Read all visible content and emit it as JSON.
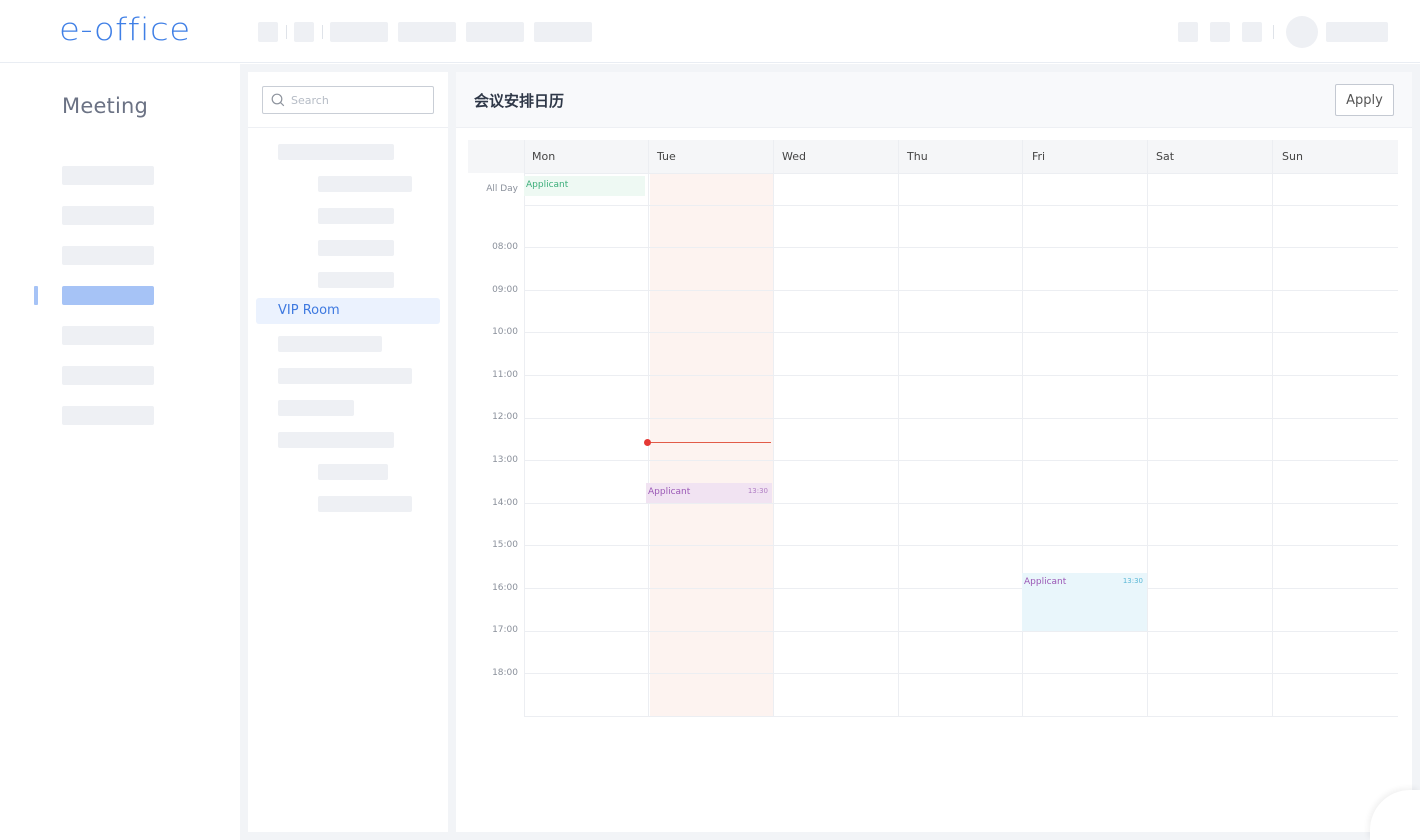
{
  "app": {
    "logo_text": "e-office"
  },
  "sidebar": {
    "title": "Meeting",
    "active_index": 3
  },
  "rooms": {
    "search_placeholder": "Search",
    "active_room": "VIP Room"
  },
  "calendar": {
    "title": "会议安排日历",
    "apply_label": "Apply",
    "days": [
      "Mon",
      "Tue",
      "Wed",
      "Thu",
      "Fri",
      "Sat",
      "Sun"
    ],
    "all_day_label": "All Day",
    "times": [
      "08:00",
      "09:00",
      "10:00",
      "11:00",
      "12:00",
      "13:00",
      "14:00",
      "15:00",
      "16:00",
      "17:00",
      "18:00"
    ],
    "today": "Tue",
    "events": [
      {
        "day": "Mon",
        "slot": "All Day",
        "name": "Applicant",
        "time": ""
      },
      {
        "day": "Tue",
        "slot": "13:30",
        "name": "Applicant",
        "time": "13:30"
      },
      {
        "day": "Fri",
        "slot": "15:30",
        "name": "Applicant",
        "time": "13:30"
      }
    ]
  },
  "colors": {
    "brand": "#3f7fe6",
    "today_bg": "#fdf3f0",
    "now_line": "#e25b48",
    "allday_event": "#eef9f3",
    "tue_event": "#f1e3f2",
    "fri_event": "#e9f6fb"
  }
}
